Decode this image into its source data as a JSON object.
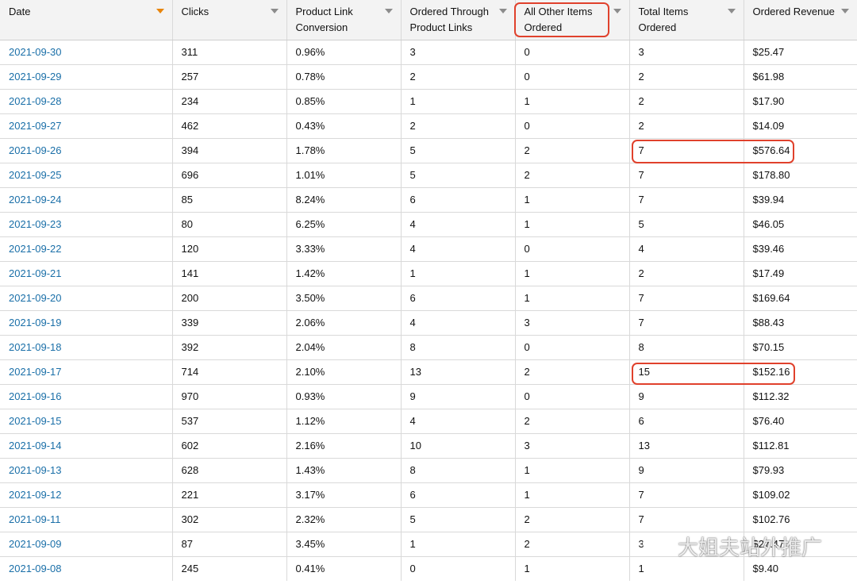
{
  "table": {
    "headers": [
      {
        "label": "Date",
        "sorted": true
      },
      {
        "label": "Clicks",
        "sorted": false
      },
      {
        "label": "Product Link Conversion",
        "sorted": false
      },
      {
        "label": "Ordered Through Product Links",
        "sorted": false
      },
      {
        "label": "All Other Items Ordered",
        "sorted": false
      },
      {
        "label": "Total Items Ordered",
        "sorted": false
      },
      {
        "label": "Ordered Revenue",
        "sorted": false
      }
    ],
    "rows": [
      [
        "2021-09-30",
        "311",
        "0.96%",
        "3",
        "0",
        "3",
        "$25.47"
      ],
      [
        "2021-09-29",
        "257",
        "0.78%",
        "2",
        "0",
        "2",
        "$61.98"
      ],
      [
        "2021-09-28",
        "234",
        "0.85%",
        "1",
        "1",
        "2",
        "$17.90"
      ],
      [
        "2021-09-27",
        "462",
        "0.43%",
        "2",
        "0",
        "2",
        "$14.09"
      ],
      [
        "2021-09-26",
        "394",
        "1.78%",
        "5",
        "2",
        "7",
        "$576.64"
      ],
      [
        "2021-09-25",
        "696",
        "1.01%",
        "5",
        "2",
        "7",
        "$178.80"
      ],
      [
        "2021-09-24",
        "85",
        "8.24%",
        "6",
        "1",
        "7",
        "$39.94"
      ],
      [
        "2021-09-23",
        "80",
        "6.25%",
        "4",
        "1",
        "5",
        "$46.05"
      ],
      [
        "2021-09-22",
        "120",
        "3.33%",
        "4",
        "0",
        "4",
        "$39.46"
      ],
      [
        "2021-09-21",
        "141",
        "1.42%",
        "1",
        "1",
        "2",
        "$17.49"
      ],
      [
        "2021-09-20",
        "200",
        "3.50%",
        "6",
        "1",
        "7",
        "$169.64"
      ],
      [
        "2021-09-19",
        "339",
        "2.06%",
        "4",
        "3",
        "7",
        "$88.43"
      ],
      [
        "2021-09-18",
        "392",
        "2.04%",
        "8",
        "0",
        "8",
        "$70.15"
      ],
      [
        "2021-09-17",
        "714",
        "2.10%",
        "13",
        "2",
        "15",
        "$152.16"
      ],
      [
        "2021-09-16",
        "970",
        "0.93%",
        "9",
        "0",
        "9",
        "$112.32"
      ],
      [
        "2021-09-15",
        "537",
        "1.12%",
        "4",
        "2",
        "6",
        "$76.40"
      ],
      [
        "2021-09-14",
        "602",
        "2.16%",
        "10",
        "3",
        "13",
        "$112.81"
      ],
      [
        "2021-09-13",
        "628",
        "1.43%",
        "8",
        "1",
        "9",
        "$79.93"
      ],
      [
        "2021-09-12",
        "221",
        "3.17%",
        "6",
        "1",
        "7",
        "$109.02"
      ],
      [
        "2021-09-11",
        "302",
        "2.32%",
        "5",
        "2",
        "7",
        "$102.76"
      ],
      [
        "2021-09-09",
        "87",
        "3.45%",
        "1",
        "2",
        "3",
        "$27.47"
      ],
      [
        "2021-09-08",
        "245",
        "0.41%",
        "0",
        "1",
        "1",
        "$9.40"
      ]
    ]
  },
  "watermark": {
    "text": "大姐夫站外推广",
    "icon": "wechat-icon"
  },
  "colors": {
    "link": "#1a6fa8",
    "highlight": "#e0412c",
    "sort_active": "#e8850c",
    "header_bg": "#f3f3f3"
  }
}
